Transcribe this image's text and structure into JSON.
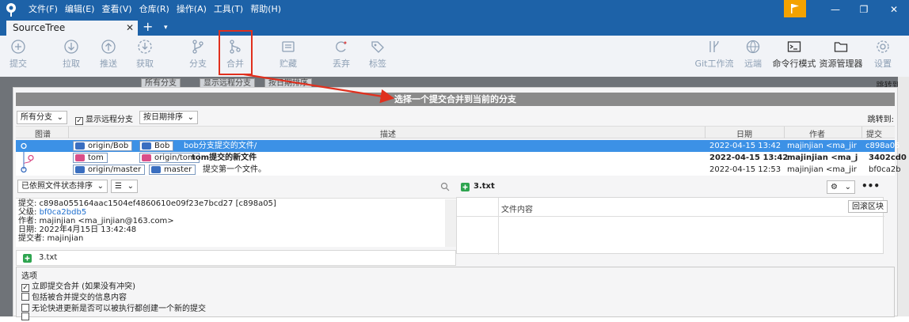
{
  "menu": [
    "文件(F)",
    "编辑(E)",
    "查看(V)",
    "仓库(R)",
    "操作(A)",
    "工具(T)",
    "帮助(H)"
  ],
  "window_controls": {
    "minimize": "—",
    "restore": "❐",
    "close": "✕"
  },
  "tab": {
    "title": "SourceTree",
    "close": "✕",
    "add": "+",
    "dropdown": "▾"
  },
  "toolbar": {
    "commit": "提交",
    "pull": "拉取",
    "push": "推送",
    "fetch": "获取",
    "branch": "分支",
    "merge": "合并",
    "stash": "贮藏",
    "discard": "丢弃",
    "tag": "标签",
    "gitflow": "Git工作流",
    "remote": "远端",
    "terminal": "命令行模式",
    "explorer": "资源管理器",
    "settings": "设置"
  },
  "background": {
    "branches": "所有分支",
    "show_remote": "显示远程分支",
    "sort": "按日期排序",
    "jump": "跳转到:"
  },
  "dialog": {
    "title": "选择一个提交合并到当前的分支",
    "branch_filter": "所有分支",
    "show_remote": "显示远程分支",
    "sort": "按日期排序",
    "jump_to": "跳转到:",
    "columns": {
      "graph": "图谱",
      "description": "描述",
      "date": "日期",
      "author": "作者",
      "commit": "提交"
    },
    "rows": [
      {
        "labels": [
          {
            "name": "origin/Bob",
            "color": "blue"
          },
          {
            "name": "Bob",
            "color": "blue"
          }
        ],
        "message": "bob分支提交的文件/",
        "date": "2022-04-15 13:42",
        "author": "majinjian <ma_jir",
        "hash": "c898a05",
        "selected": true
      },
      {
        "labels": [
          {
            "name": "tom",
            "color": "pink"
          },
          {
            "name": "origin/tom",
            "color": "pink"
          }
        ],
        "message": "tom提交的新文件",
        "date": "2022-04-15 13:42",
        "author": "majinjian <ma_j",
        "hash": "3402cd0",
        "bold": true
      },
      {
        "labels": [
          {
            "name": "origin/master",
            "color": "blue"
          },
          {
            "name": "master",
            "color": "blue"
          }
        ],
        "message": "提交第一个文件。",
        "date": "2022-04-15 12:53",
        "author": "majinjian <ma_jir",
        "hash": "bf0ca2b"
      }
    ],
    "file_sort": "已依照文件状态排序",
    "view_mode": "☰",
    "commit_info": {
      "commit": "提交: c898a055164aac1504ef4860610e09f23e7bcd27 [c898a05]",
      "parent_label": "父级:",
      "parent": "bf0ca2bdb5",
      "author": "作者: majinjian <ma_jinjian@163.com>",
      "date": "日期: 2022年4月15日 13:42:48",
      "committer": "提交者: majinjian"
    },
    "changed_file": "3.txt",
    "diff_file": "3.txt",
    "file_content": "文件内容",
    "revert_block": "回滚区块",
    "options_title": "选项",
    "options": [
      {
        "label": "立即提交合并 (如果没有冲突)",
        "checked": true
      },
      {
        "label": "包括被合并提交的信息内容",
        "checked": false
      },
      {
        "label": "无论快进更新是否可以被执行都创建一个新的提交",
        "checked": false
      },
      {
        "label": "",
        "checked": false
      }
    ]
  },
  "colors": {
    "titlebar": "#1d62a8",
    "selection": "#3c91e6",
    "annotation": "#e0301e",
    "flag": "#f4a200"
  }
}
